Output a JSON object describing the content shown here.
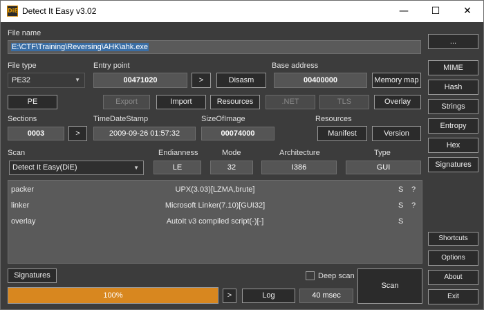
{
  "window": {
    "title": "Detect It Easy v3.02",
    "icon_text": "DiE",
    "controls": {
      "minimize": "—",
      "maximize": "☐",
      "close": "✕"
    }
  },
  "file": {
    "label": "File name",
    "path": "E:\\CTF\\Training\\Reversing\\AHK\\ahk.exe",
    "browse_label": "..."
  },
  "file_type": {
    "label": "File type",
    "value": "PE32"
  },
  "entry_point": {
    "label": "Entry point",
    "value": "00471020",
    "go_label": ">",
    "disasm_label": "Disasm"
  },
  "base_address": {
    "label": "Base address",
    "value": "00400000",
    "memory_map_label": "Memory map"
  },
  "pe_buttons": {
    "pe": "PE",
    "export": "Export",
    "import": "Import",
    "resources": "Resources",
    "net": ".NET",
    "tls": "TLS",
    "overlay": "Overlay"
  },
  "sections": {
    "label": "Sections",
    "value": "0003",
    "go_label": ">"
  },
  "timestamp": {
    "label": "TimeDateStamp",
    "value": "2009-09-26 01:57:32"
  },
  "size_of_image": {
    "label": "SizeOfImage",
    "value": "00074000"
  },
  "resources_group": {
    "label": "Resources",
    "manifest": "Manifest",
    "version": "Version"
  },
  "scan_info": {
    "scan_label": "Scan",
    "scan_engine": "Detect It Easy(DiE)",
    "endianness_label": "Endianness",
    "endianness": "LE",
    "mode_label": "Mode",
    "mode": "32",
    "architecture_label": "Architecture",
    "architecture": "I386",
    "type_label": "Type",
    "type": "GUI"
  },
  "results": [
    {
      "type": "packer",
      "name": "UPX(3.03)[LZMA,brute]",
      "s": "S",
      "q": "?"
    },
    {
      "type": "linker",
      "name": "Microsoft Linker(7.10)[GUI32]",
      "s": "S",
      "q": "?"
    },
    {
      "type": "overlay",
      "name": "AutoIt v3 compiled script(-)[-]",
      "s": "S",
      "q": ""
    }
  ],
  "right_panel": {
    "mime": "MIME",
    "hash": "Hash",
    "strings": "Strings",
    "entropy": "Entropy",
    "hex": "Hex",
    "signatures": "Signatures",
    "shortcuts": "Shortcuts",
    "options": "Options",
    "about": "About",
    "exit": "Exit"
  },
  "bottom": {
    "signatures": "Signatures",
    "deep_scan_label": "Deep scan",
    "deep_scan_checked": false,
    "progress_text": "100%",
    "progress_value": 1.0,
    "progress_color": "#d8871f",
    "next_label": ">",
    "log_label": "Log",
    "time_label": "40 msec",
    "scan_label": "Scan"
  }
}
